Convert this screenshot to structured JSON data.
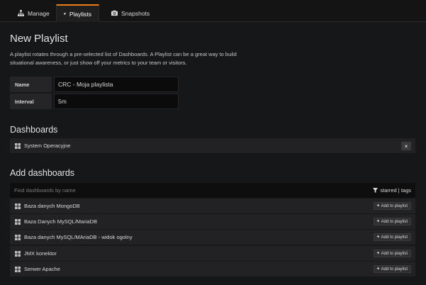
{
  "tabs": [
    {
      "label": "Manage",
      "icon": "sitemap-icon",
      "active": false
    },
    {
      "label": "Playlists",
      "icon": "playlist-icon",
      "active": true
    },
    {
      "label": "Snapshots",
      "icon": "camera-icon",
      "active": false
    }
  ],
  "page": {
    "title": "New Playlist",
    "description_line1": "A playlist rotates through a pre-selected list of Dashboards. A Playlist can be a great way to build",
    "description_line2": "situational awareness, or just show off your metrics to your team or visitors."
  },
  "form": {
    "name_label": "Name",
    "name_value": "CRC - Moja playlista",
    "interval_label": "Interval",
    "interval_value": "5m"
  },
  "dashboards": {
    "title": "Dashboards",
    "items": [
      {
        "label": "System Operacyjne",
        "remove_label": "×"
      }
    ]
  },
  "add_dashboards": {
    "title": "Add dashboards",
    "search_placeholder": "Find dashboards by name",
    "filter_label": "starred | tags",
    "add_label": "Add to playlist",
    "items": [
      {
        "label": "Baza danych MongoDB"
      },
      {
        "label": "Baza Danych MySQL/MariaDB"
      },
      {
        "label": "Baza danych MySQL/MAriaDB - widok ogolny"
      },
      {
        "label": "JMX konektor"
      },
      {
        "label": "Serwer Apache"
      }
    ]
  },
  "colors": {
    "accent": "#eb7b18",
    "background": "#161719",
    "row": "#222224"
  }
}
